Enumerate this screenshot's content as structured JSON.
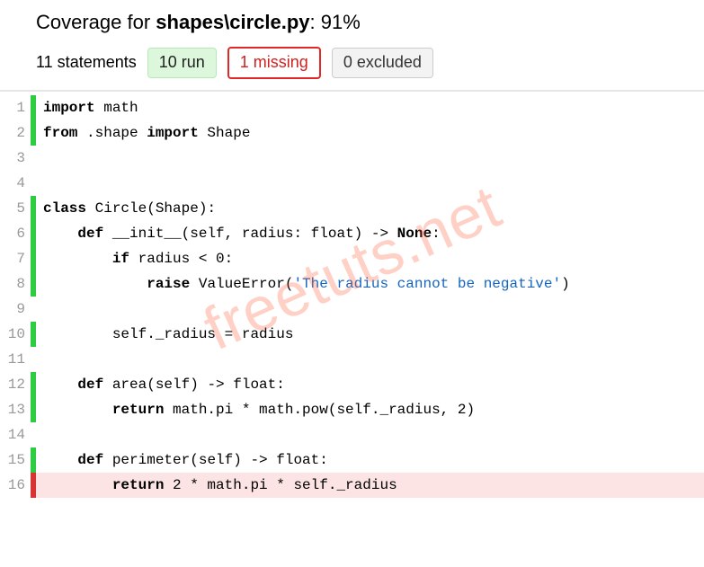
{
  "header": {
    "prefix": "Coverage for ",
    "file": "shapes\\circle.py",
    "percent": ": 91%",
    "statements": "11 statements",
    "run": "10 run",
    "missing": "1 missing",
    "excluded": "0 excluded"
  },
  "watermark": "freetuts.net",
  "code": {
    "lines": [
      {
        "n": 1,
        "status": "run",
        "tokens": [
          {
            "t": "import",
            "c": "kw"
          },
          {
            "t": " math"
          }
        ]
      },
      {
        "n": 2,
        "status": "run",
        "tokens": [
          {
            "t": "from",
            "c": "kw"
          },
          {
            "t": " .shape "
          },
          {
            "t": "import",
            "c": "kw"
          },
          {
            "t": " Shape"
          }
        ]
      },
      {
        "n": 3,
        "status": "",
        "tokens": []
      },
      {
        "n": 4,
        "status": "",
        "tokens": []
      },
      {
        "n": 5,
        "status": "run",
        "tokens": [
          {
            "t": "class",
            "c": "kw"
          },
          {
            "t": " Circle(Shape):"
          }
        ]
      },
      {
        "n": 6,
        "status": "run",
        "tokens": [
          {
            "t": "    "
          },
          {
            "t": "def",
            "c": "kw"
          },
          {
            "t": " __init__(self, radius: float) -> "
          },
          {
            "t": "None",
            "c": "kw"
          },
          {
            "t": ":"
          }
        ]
      },
      {
        "n": 7,
        "status": "run",
        "tokens": [
          {
            "t": "        "
          },
          {
            "t": "if",
            "c": "kw"
          },
          {
            "t": " radius < 0:"
          }
        ]
      },
      {
        "n": 8,
        "status": "run",
        "tokens": [
          {
            "t": "            "
          },
          {
            "t": "raise",
            "c": "kw"
          },
          {
            "t": " ValueError("
          },
          {
            "t": "'The radius cannot be negative'",
            "c": "str"
          },
          {
            "t": ")"
          }
        ]
      },
      {
        "n": 9,
        "status": "",
        "tokens": []
      },
      {
        "n": 10,
        "status": "run",
        "tokens": [
          {
            "t": "        self._radius = radius"
          }
        ]
      },
      {
        "n": 11,
        "status": "",
        "tokens": []
      },
      {
        "n": 12,
        "status": "run",
        "tokens": [
          {
            "t": "    "
          },
          {
            "t": "def",
            "c": "kw"
          },
          {
            "t": " area(self) -> float:"
          }
        ]
      },
      {
        "n": 13,
        "status": "run",
        "tokens": [
          {
            "t": "        "
          },
          {
            "t": "return",
            "c": "kw"
          },
          {
            "t": " math.pi * math.pow(self._radius, 2)"
          }
        ]
      },
      {
        "n": 14,
        "status": "",
        "tokens": []
      },
      {
        "n": 15,
        "status": "run",
        "tokens": [
          {
            "t": "    "
          },
          {
            "t": "def",
            "c": "kw"
          },
          {
            "t": " perimeter(self) -> float:"
          }
        ]
      },
      {
        "n": 16,
        "status": "miss",
        "tokens": [
          {
            "t": "        "
          },
          {
            "t": "return",
            "c": "kw"
          },
          {
            "t": " 2 * math.pi * self._radius"
          }
        ]
      }
    ]
  }
}
